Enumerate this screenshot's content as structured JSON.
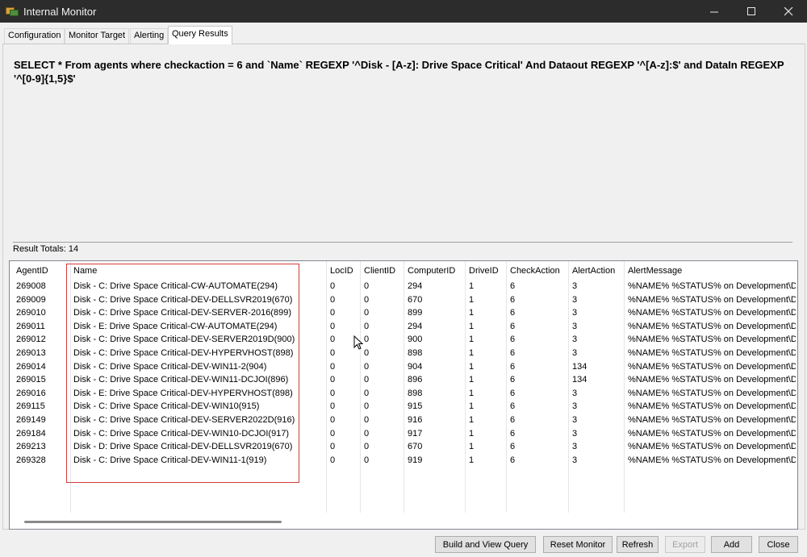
{
  "window": {
    "title": "Internal Monitor",
    "minimize_glyph": "—",
    "maximize_glyph": "☐",
    "close_glyph": "✕"
  },
  "tabs": [
    {
      "label": "Configuration",
      "active": false
    },
    {
      "label": "Monitor Target",
      "active": false
    },
    {
      "label": "Alerting",
      "active": false
    },
    {
      "label": "Query Results",
      "active": true
    }
  ],
  "query": {
    "text": "SELECT * From agents where checkaction = 6 and `Name` REGEXP '^Disk - [A-z]: Drive Space Critical' And Dataout REGEXP '^[A-z]:$' and DataIn REGEXP '^[0-9]{1,5}$'"
  },
  "results": {
    "totals_label": "Result Totals: 14",
    "columns": [
      "AgentID",
      "Name",
      "LocID",
      "ClientID",
      "ComputerID",
      "DriveID",
      "CheckAction",
      "AlertAction",
      "AlertMessage"
    ],
    "rows": [
      [
        "269008",
        "Disk - C: Drive Space Critical-CW-AUTOMATE(294)",
        "0",
        "0",
        "294",
        "1",
        "6",
        "3",
        "%NAME% %STATUS% on Development\\Dev"
      ],
      [
        "269009",
        "Disk - C: Drive Space Critical-DEV-DELLSVR2019(670)",
        "0",
        "0",
        "670",
        "1",
        "6",
        "3",
        "%NAME% %STATUS% on Development\\Dev"
      ],
      [
        "269010",
        "Disk - C: Drive Space Critical-DEV-SERVER-2016(899)",
        "0",
        "0",
        "899",
        "1",
        "6",
        "3",
        "%NAME% %STATUS% on Development\\Dev"
      ],
      [
        "269011",
        "Disk - E: Drive Space Critical-CW-AUTOMATE(294)",
        "0",
        "0",
        "294",
        "1",
        "6",
        "3",
        "%NAME% %STATUS% on Development\\Dev"
      ],
      [
        "269012",
        "Disk - C: Drive Space Critical-DEV-SERVER2019D(900)",
        "0",
        "0",
        "900",
        "1",
        "6",
        "3",
        "%NAME% %STATUS% on Development\\Dev"
      ],
      [
        "269013",
        "Disk - C: Drive Space Critical-DEV-HYPERVHOST(898)",
        "0",
        "0",
        "898",
        "1",
        "6",
        "3",
        "%NAME% %STATUS% on Development\\Dev"
      ],
      [
        "269014",
        "Disk - C: Drive Space Critical-DEV-WIN11-2(904)",
        "0",
        "0",
        "904",
        "1",
        "6",
        "134",
        "%NAME% %STATUS% on Development\\Dev"
      ],
      [
        "269015",
        "Disk - C: Drive Space Critical-DEV-WIN11-DCJOI(896)",
        "0",
        "0",
        "896",
        "1",
        "6",
        "134",
        "%NAME% %STATUS% on Development\\Dev"
      ],
      [
        "269016",
        "Disk - E: Drive Space Critical-DEV-HYPERVHOST(898)",
        "0",
        "0",
        "898",
        "1",
        "6",
        "3",
        "%NAME% %STATUS% on Development\\Dev"
      ],
      [
        "269115",
        "Disk - C: Drive Space Critical-DEV-WIN10(915)",
        "0",
        "0",
        "915",
        "1",
        "6",
        "3",
        "%NAME% %STATUS% on Development\\Dev"
      ],
      [
        "269149",
        "Disk - C: Drive Space Critical-DEV-SERVER2022D(916)",
        "0",
        "0",
        "916",
        "1",
        "6",
        "3",
        "%NAME% %STATUS% on Development\\Dev"
      ],
      [
        "269184",
        "Disk - C: Drive Space Critical-DEV-WIN10-DCJOI(917)",
        "0",
        "0",
        "917",
        "1",
        "6",
        "3",
        "%NAME% %STATUS% on Development\\Dev"
      ],
      [
        "269213",
        "Disk - D: Drive Space Critical-DEV-DELLSVR2019(670)",
        "0",
        "0",
        "670",
        "1",
        "6",
        "3",
        "%NAME% %STATUS% on Development\\Dev"
      ],
      [
        "269328",
        "Disk - C: Drive Space Critical-DEV-WIN11-1(919)",
        "0",
        "0",
        "919",
        "1",
        "6",
        "3",
        "%NAME% %STATUS% on Development\\Dev"
      ]
    ]
  },
  "buttons": {
    "build_view_query": "Build and View Query",
    "reset_monitor": "Reset Monitor",
    "refresh": "Refresh",
    "export": "Export",
    "add": "Add",
    "close": "Close"
  },
  "colors": {
    "titlebar": "#2c2c2c",
    "highlight_box": "#d63a3a"
  }
}
